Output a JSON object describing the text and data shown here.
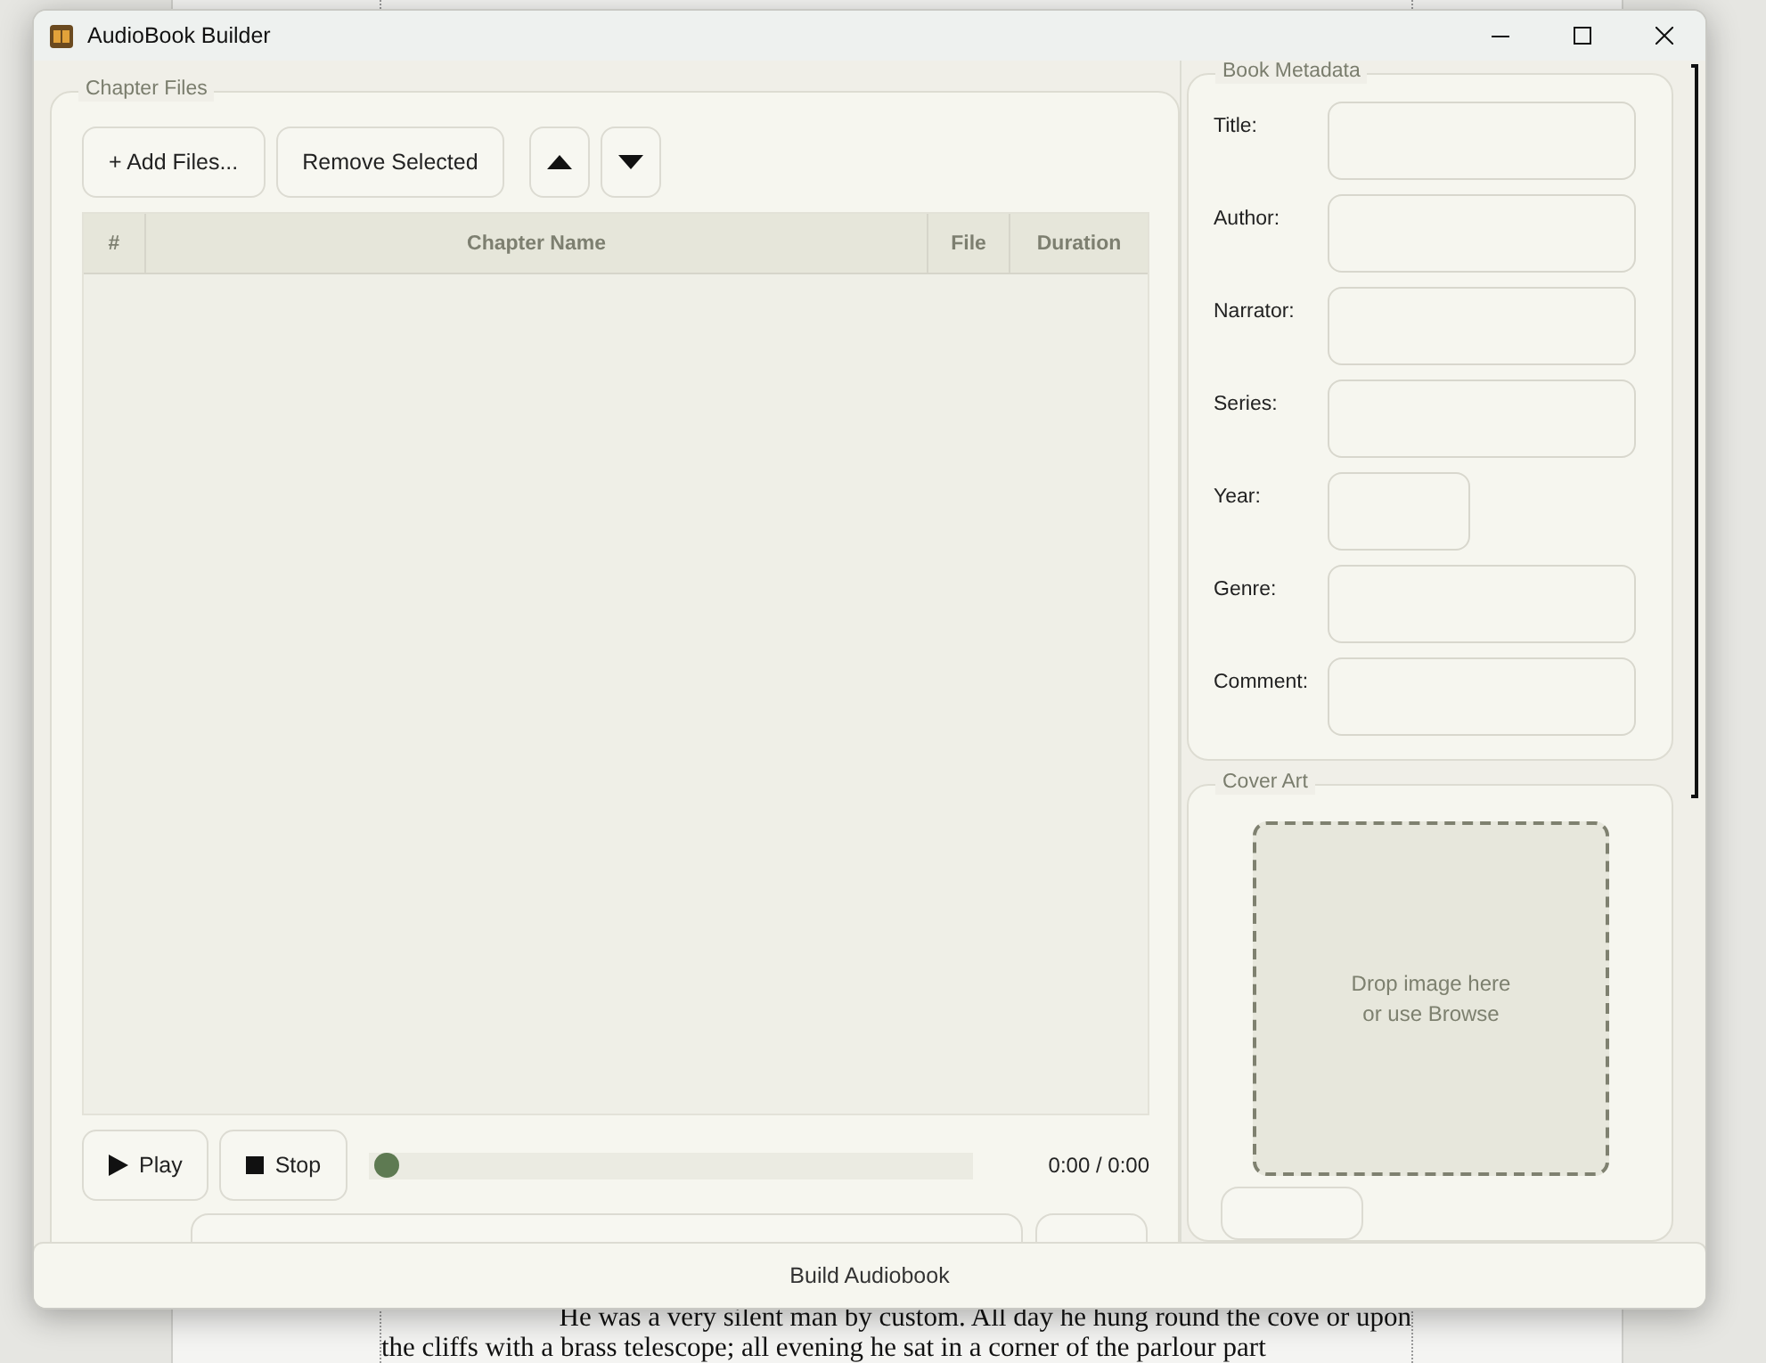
{
  "background_document": {
    "lines": [
      "He was a very silent man by custom. All day he hung round the cove or upon",
      "the cliffs with a brass telescope; all evening he sat in a corner of the parlour part"
    ]
  },
  "window": {
    "title": "AudioBook Builder"
  },
  "chapter_files": {
    "title": "Chapter Files",
    "buttons": [
      "+ Add Files...",
      "Remove Selected"
    ],
    "move_buttons": [
      {
        "kind": "up"
      },
      {
        "kind": "down"
      }
    ],
    "table": {
      "columns": [
        "#",
        "Chapter Name",
        "File",
        "Duration"
      ]
    }
  },
  "player": {
    "buttons": [
      {
        "kind": "play",
        "label": "Play"
      },
      {
        "kind": "stop",
        "label": "Stop"
      }
    ],
    "position": {
      "level": 0
    },
    "time": "0:00 / 0:00"
  },
  "metadata": {
    "title": "Book Metadata",
    "fields": [
      {
        "label": "Title:",
        "kind": "wide"
      },
      {
        "label": "Author:",
        "kind": "wide"
      },
      {
        "label": "Narrator:",
        "kind": "wide"
      },
      {
        "label": "Series:",
        "kind": "wide"
      },
      {
        "label": "Year:",
        "kind": "short"
      },
      {
        "label": "Genre:",
        "kind": "wide"
      },
      {
        "label": "Comment:",
        "kind": "wide"
      }
    ]
  },
  "cover_art": {
    "title": "Cover Art",
    "drop_hint": "Drop image here\nor use Browse"
  },
  "build_button": "Build Audiobook"
}
